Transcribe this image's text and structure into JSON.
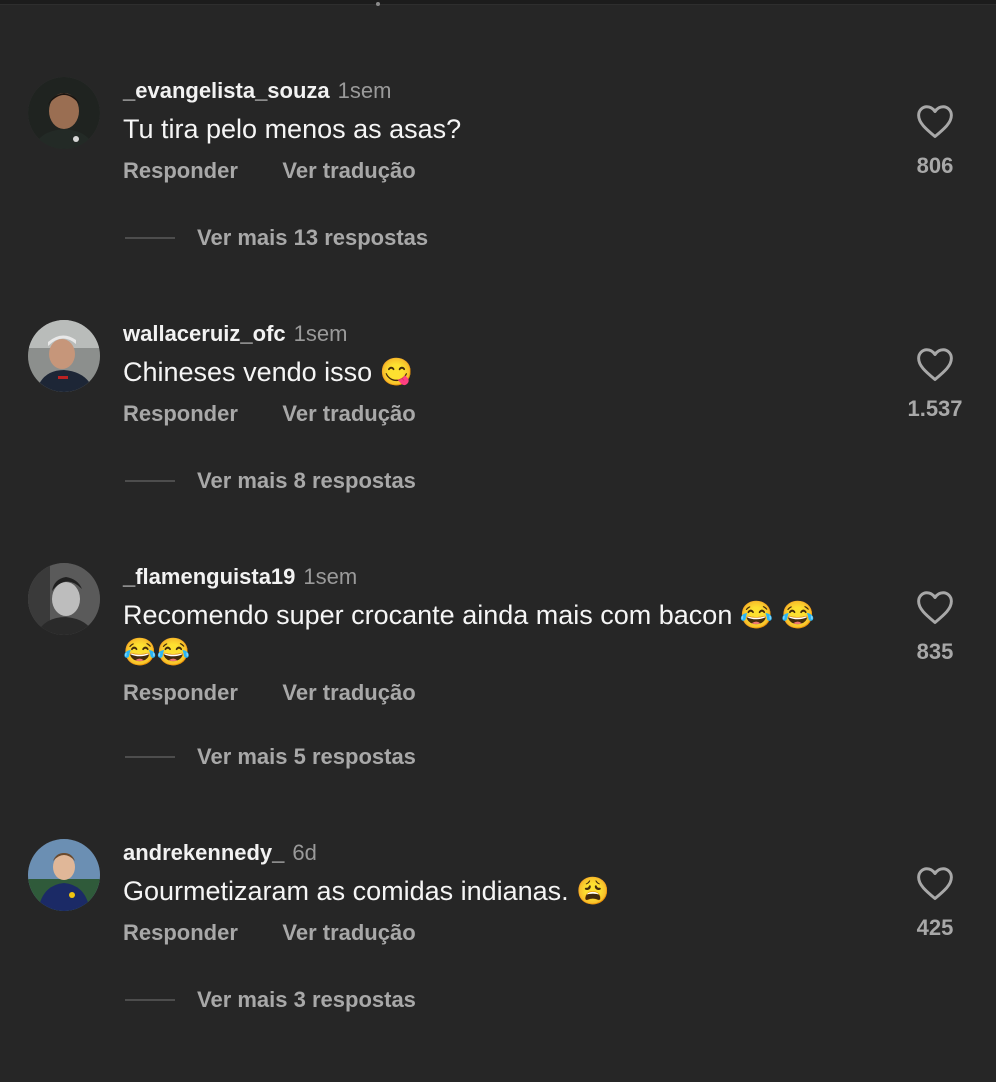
{
  "comments": [
    {
      "username": "_evangelista_souza",
      "time": "1sem",
      "text": "Tu tira pelo menos as asas?",
      "reply_label": "Responder",
      "translate_label": "Ver tradução",
      "likes": "806",
      "more_replies": "Ver mais 13 respostas"
    },
    {
      "username": "wallaceruiz_ofc",
      "time": "1sem",
      "text": "Chineses vendo isso 😋",
      "reply_label": "Responder",
      "translate_label": "Ver tradução",
      "likes": "1.537",
      "more_replies": "Ver mais 8 respostas"
    },
    {
      "username": "_flamenguista19",
      "time": "1sem",
      "text": "Recomendo super crocante ainda mais com bacon 😂 😂😂😂",
      "reply_label": "Responder",
      "translate_label": "Ver tradução",
      "likes": "835",
      "more_replies": "Ver mais 5 respostas"
    },
    {
      "username": "andrekennedy_",
      "time": "6d",
      "text": "Gourmetizaram as comidas indianas. 😩",
      "reply_label": "Responder",
      "translate_label": "Ver tradução",
      "likes": "425",
      "more_replies": "Ver mais 3 respostas"
    }
  ],
  "icons": {
    "like": "heart-outline-icon"
  },
  "colors": {
    "background": "#262626",
    "text": "#f5f5f5",
    "secondary": "#a8a8a8"
  }
}
